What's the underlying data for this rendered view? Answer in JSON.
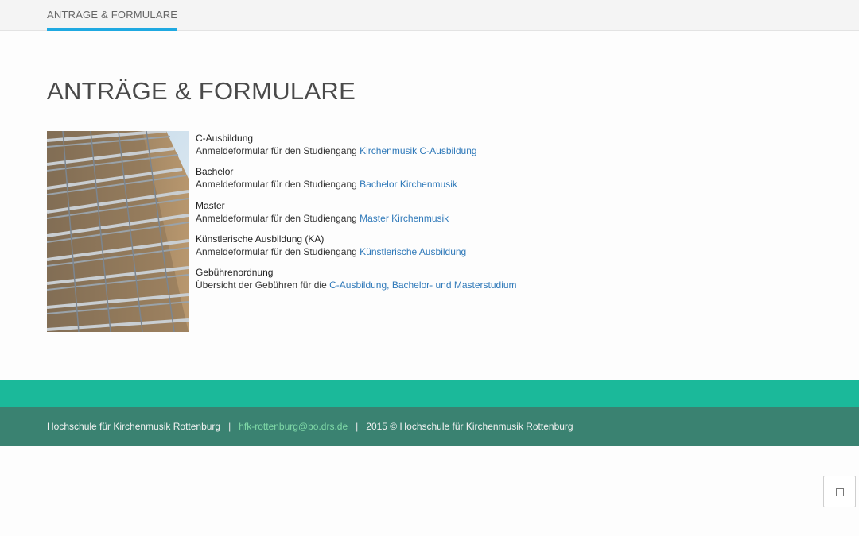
{
  "nav": {
    "active_tab": "ANTRÄGE & FORMULARE"
  },
  "page": {
    "title": "ANTRÄGE & FORMULARE"
  },
  "forms": [
    {
      "heading": "C-Ausbildung",
      "text": "Anmeldeformular für den Studiengang",
      "link": "Kirchenmusik C-Ausbildung"
    },
    {
      "heading": "Bachelor",
      "text": "Anmeldeformular für den Studiengang",
      "link": "Bachelor Kirchenmusik"
    },
    {
      "heading": "Master",
      "text": "Anmeldeformular für den Studiengang",
      "link": "Master Kirchenmusik"
    },
    {
      "heading": "Künstlerische Ausbildung (KA)",
      "text": "Anmeldeformular für den Studiengang",
      "link": "Künstlerische Ausbildung"
    },
    {
      "heading": "Gebührenordnung",
      "text": "Übersicht der Gebühren für die",
      "link": "C-Ausbildung, Bachelor- und Masterstudium"
    }
  ],
  "footer": {
    "org": "Hochschule für Kirchenmusik Rottenburg",
    "sep1": "|",
    "email": "hfk-rottenburg@bo.drs.de",
    "sep2": "|",
    "copyright": "2015 © Hochschule für Kirchenmusik Rottenburg"
  },
  "icons": {
    "scroll_top": "square-icon",
    "building": "building-facade-photo"
  },
  "colors": {
    "accent_tab": "#1fa9e1",
    "link": "#2f79b9",
    "footer_band": "#1bb99a",
    "footer": "#3a8271",
    "footer_email": "#7fd9a7"
  }
}
